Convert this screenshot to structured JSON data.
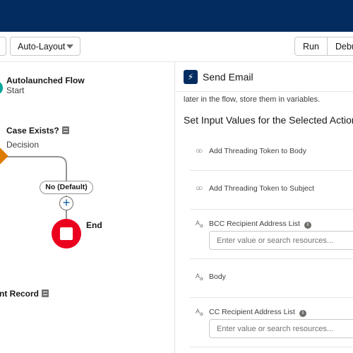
{
  "toolbar": {
    "layout_select": "Auto-Layout",
    "run_label": "Run",
    "debug_label": "Debu"
  },
  "canvas": {
    "start": {
      "title": "Autolaunched Flow",
      "subtitle": "Start"
    },
    "decision": {
      "title": "Case Exists?",
      "subtitle": "Decision"
    },
    "branch_label": "No (Default)",
    "end_label": "End",
    "record_node": {
      "title": "nt Record"
    }
  },
  "panel": {
    "title": "Send Email",
    "description": "later in the flow, store them in variables.",
    "section_title": "Set Input Values for the Selected Action",
    "fields": [
      {
        "label": "Add Threading Token to Body",
        "icon": "toggle-icon"
      },
      {
        "label": "Add Threading Token to Subject",
        "icon": "toggle-icon"
      },
      {
        "label": "BCC Recipient Address List",
        "icon": "text-icon",
        "placeholder": "Enter value or search resources..."
      },
      {
        "label": "Body",
        "icon": "text-icon"
      },
      {
        "label": "CC Recipient Address List",
        "icon": "text-icon",
        "placeholder": "Enter value or search resources..."
      }
    ],
    "text_icon_glyph": "Aa",
    "toggle_icon_glyph": "ↂ",
    "info_glyph": "i"
  },
  "colors": {
    "header": "#032d60",
    "decision": "#dd7a01",
    "end": "#ea001e",
    "start": "#06a59a",
    "action_icon": "#032d60"
  }
}
